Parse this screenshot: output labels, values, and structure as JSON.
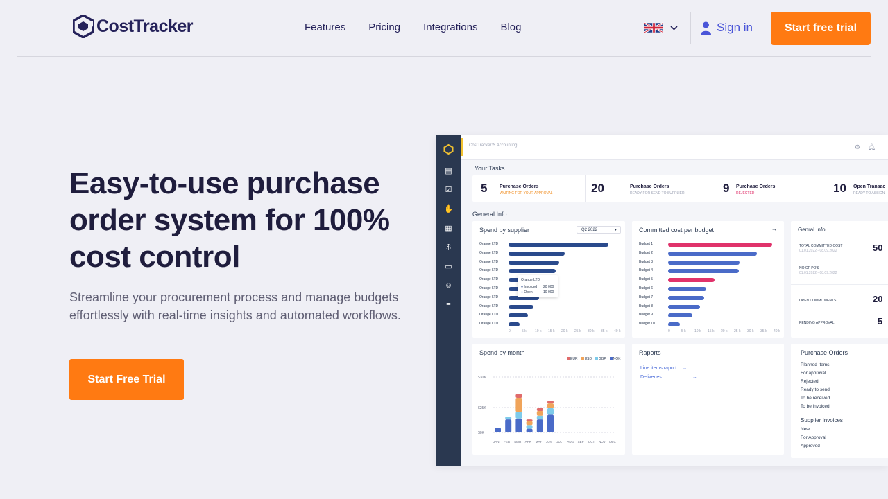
{
  "brand": {
    "name": "CostTracker",
    "accent": "#ff7a12"
  },
  "nav": {
    "items": [
      "Features",
      "Pricing",
      "Integrations",
      "Blog"
    ],
    "language_icon": "uk-flag-icon",
    "signin": "Sign in",
    "cta": "Start free trial"
  },
  "hero": {
    "title": "Easy-to-use purchase order system for 100% cost control",
    "subtitle": "Streamline your procurement process and manage budgets effortlessly with real-time insights and automated workflows.",
    "cta": "Start Free Trial"
  },
  "dashboard": {
    "breadcrumb": "CostTracker™ Accounting",
    "tasks_label": "Your Tasks",
    "tasks": [
      {
        "num": "5",
        "title": "Purchase Orders",
        "status": "WAITING FOR YOUR APPROVAL",
        "status_color": "#f08a1a"
      },
      {
        "num": "20",
        "title": "Purchase Orders",
        "status": "READY FOR SEND TO SUPPLIER",
        "status_color": "#9aa0b2"
      },
      {
        "num": "9",
        "title": "Purchase Orders",
        "status": "REJECTED",
        "status_color": "#e0326b"
      },
      {
        "num": "10",
        "title": "Open Transac",
        "status": "READY TO ASSIGN",
        "status_color": "#9aa0b2"
      }
    ],
    "general_label": "General Info",
    "supplier": {
      "title": "Spend by supplier",
      "filter": "Q2 2022",
      "labels": [
        "Orange LTD",
        "Orange LTD",
        "Orange LTD",
        "Orange LTD",
        "Orange LTD",
        "Orange LTD",
        "Orange LTD",
        "Orange LTD",
        "Orange LTD",
        "Orange LTD"
      ],
      "values": [
        0.97,
        0.55,
        0.49,
        0.46,
        0.4,
        0.34,
        0.3,
        0.24,
        0.19,
        0.11
      ],
      "tooltip": {
        "title": "Orange LTD",
        "r1": "Invoiced",
        "v1": "20 000",
        "r2": "Open",
        "v2": "10 000"
      },
      "ticks": [
        "0",
        "5 k",
        "10 k",
        "15 k",
        "20 k",
        "25 k",
        "30 k",
        "35 k",
        "40 k"
      ]
    },
    "budget": {
      "title": "Committed cost per budget",
      "labels": [
        "Budget 1",
        "Budget 2",
        "Budget 3",
        "Budget 4",
        "Budget 5",
        "Budget 6",
        "Budget 7",
        "Budget 8",
        "Budget 9",
        "Budget 10"
      ],
      "values": [
        0.99,
        0.84,
        0.68,
        0.67,
        0.44,
        0.36,
        0.34,
        0.3,
        0.23,
        0.11
      ],
      "colors": [
        "#e0326b",
        "#4a6bc8",
        "#4a6bc8",
        "#4a6bc8",
        "#e0326b",
        "#4a6bc8",
        "#4a6bc8",
        "#4a6bc8",
        "#4a6bc8",
        "#4a6bc8"
      ],
      "ticks": [
        "0",
        "5 k",
        "10 k",
        "15 k",
        "20 k",
        "25 k",
        "30 k",
        "35 k",
        "40 k"
      ]
    },
    "info": {
      "title": "Genral Info",
      "rows": [
        {
          "label": "TOTAL COMMITTED COST",
          "sub": "01.01.2022 - 08.09.2022",
          "value": "50"
        },
        {
          "label": "NO OF PO'S",
          "sub": "01.01.2022 - 08.09.2022",
          "value": ""
        },
        {
          "label": "OPEN COMMITMENTS",
          "sub": "",
          "value": "20"
        },
        {
          "label": "PENDING APPROVAL",
          "sub": "",
          "value": "5"
        }
      ]
    },
    "month": {
      "title": "Spend by month",
      "legend": [
        "EUR",
        "USD",
        "GBP",
        "NOK"
      ],
      "legend_colors": [
        "#e06b6b",
        "#f0a45a",
        "#7ecbea",
        "#4a6bc8"
      ],
      "y_ticks": [
        "$30K",
        "$25K",
        "$0K"
      ],
      "months": [
        "JAN",
        "FEB",
        "MAR",
        "APR",
        "MAY",
        "JUN",
        "JUL",
        "AUG",
        "SEP",
        "OCT",
        "NOV",
        "DEC"
      ],
      "stacks": [
        [
          0,
          0,
          0,
          5
        ],
        [
          0,
          0,
          3,
          14
        ],
        [
          4,
          15,
          7,
          15
        ],
        [
          2,
          4,
          4,
          4
        ],
        [
          3,
          5,
          4,
          14
        ],
        [
          3,
          5,
          7,
          19
        ],
        [
          0,
          0,
          0,
          0
        ],
        [
          0,
          0,
          0,
          0
        ],
        [
          0,
          0,
          0,
          0
        ],
        [
          0,
          0,
          0,
          0
        ],
        [
          0,
          0,
          0,
          0
        ],
        [
          0,
          0,
          0,
          0
        ]
      ]
    },
    "reports": {
      "title": "Raports",
      "links": [
        "Line items raport",
        "Deliveries"
      ]
    },
    "po": {
      "title": "Purchase Orders",
      "items": [
        "Planned Items",
        "For approval",
        "Rejected",
        "Ready to send",
        "To be received",
        "To be invoiced"
      ],
      "invoices_title": "Supplier Invoices",
      "invoices": [
        "New",
        "For Approval",
        "Approved"
      ]
    }
  }
}
